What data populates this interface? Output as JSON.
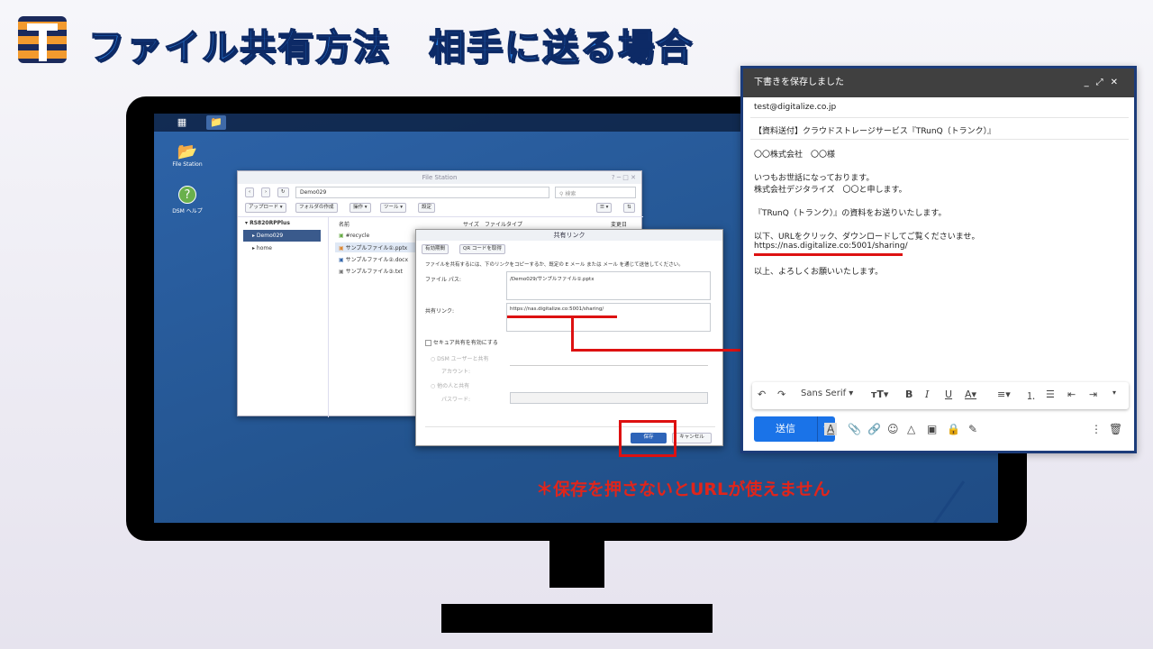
{
  "title": "ファイル共有方法　相手に送る場合",
  "dsm": {
    "desktop_icons": [
      "File Station",
      "DSM ヘルプ"
    ],
    "file_station": {
      "window_title": "File Station",
      "path": "Demo029",
      "search_placeholder": "検索",
      "toolbar": [
        "アップロード ▾",
        "フォルダの作成",
        "操作 ▾",
        "ツール ▾",
        "設定"
      ],
      "tree_root": "RS820RPPlus",
      "tree_items": [
        "Demo029",
        "home"
      ],
      "columns": [
        "名前",
        "サイズ",
        "ファイルタイプ",
        "変更日"
      ],
      "files": [
        "#recycle",
        "サンプルファイル①.pptx",
        "サンプルファイル②.docx",
        "サンプルファイル③.txt"
      ]
    },
    "share_dialog": {
      "title": "共有リンク",
      "tabs": [
        "有効期間",
        "QR コードを取得"
      ],
      "instruction": "ファイルを共有するには、下のリンクをコピーするか、既定の E メール または メール を通じて送信してください。",
      "file_path_label": "ファイル パス:",
      "file_path_value": "/Demo029/サンプルファイル①.pptx",
      "share_link_label": "共有リンク:",
      "share_link_value": "https://nas.digitalize.co:5001/sharing/",
      "secure_label": "セキュア共有を有効にする",
      "dsm_user_label": "DSM ユーザーと共有",
      "account_label": "アカウント:",
      "others_label": "他の人と共有",
      "password_label": "パスワード:",
      "save_label": "保存",
      "cancel_label": "キャンセル"
    }
  },
  "note": "＊保存を押さないとURLが使えません",
  "gmail": {
    "header": "下書きを保存しました",
    "header_icons": [
      "_",
      "⤢",
      "✕"
    ],
    "to": "test@digitalize.co.jp",
    "subject": "【資料送付】クラウドストレージサービス『TRunQ（トランク）』",
    "body": [
      "〇〇株式会社　〇〇様",
      "いつもお世話になっております。",
      "株式会社デジタライズ　〇〇と申します。",
      "『TRunQ（トランク）』の資料をお送りいたします。",
      "以下、URLをクリック、ダウンロードしてご覧くださいませ。",
      "https://nas.digitalize.co:5001/sharing/",
      "以上、よろしくお願いいたします。"
    ],
    "font": "Sans Serif",
    "send_label": "送信"
  },
  "colors": {
    "accent_red": "#e0251b",
    "gmail_blue": "#1a73e8",
    "title_blue": "#2a7fe0"
  }
}
